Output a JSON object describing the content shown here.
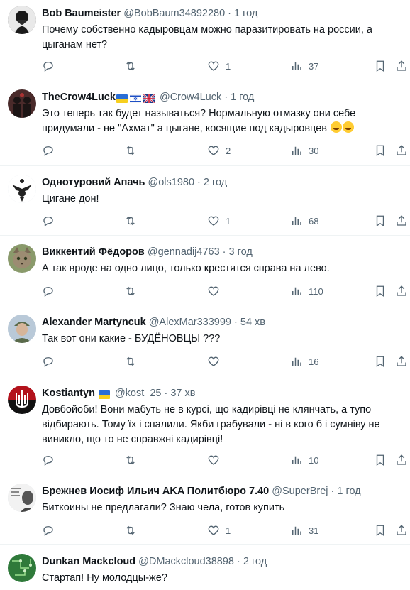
{
  "tweets": [
    {
      "name": "Bob Baumeister",
      "handle": "@BobBaum34892280",
      "time": "1 год",
      "text": "Почему собственно кадыровцам можно паразитировать на россии, а цыганам нет?",
      "replies": "",
      "reposts": "",
      "likes": "1",
      "views": "37",
      "avatar_icon": "bearded-man-avatar",
      "flags": []
    },
    {
      "name": "TheCrow4Luck",
      "handle": "@Crow4Luck",
      "time": "1 год",
      "text": "Это теперь так будет называться? Нормальную отмазку они себе придумали - не \"Ахмат\" а цыгане, косящие под кадыровцев",
      "emojis": [
        "rolling-laughing-emoji",
        "rolling-laughing-emoji"
      ],
      "replies": "",
      "reposts": "",
      "likes": "2",
      "views": "30",
      "avatar_icon": "dark-figures-avatar",
      "flags": [
        "ukraine-flag-icon",
        "israel-flag-icon",
        "uk-flag-icon"
      ]
    },
    {
      "name": "Однотуровий Апачь",
      "handle": "@ols1980",
      "time": "2 год",
      "text": "Цигане дон!",
      "replies": "",
      "reposts": "",
      "likes": "1",
      "views": "68",
      "avatar_icon": "eagle-emblem-avatar",
      "flags": []
    },
    {
      "name": "Виккентий Фёдоров",
      "handle": "@gennadij4763",
      "time": "3 год",
      "text": "А так вроде на одно лицо, только крестятся справа на лево.",
      "replies": "",
      "reposts": "",
      "likes": "",
      "views": "110",
      "avatar_icon": "cat-avatar",
      "flags": []
    },
    {
      "name": "Alexander Martyncuk",
      "handle": "@AlexMar333999",
      "time": "54 хв",
      "text": "Так вот они какие  - БУДЁНОВЦЫ ???",
      "replies": "",
      "reposts": "",
      "likes": "",
      "views": "16",
      "avatar_icon": "soldier-photo-avatar",
      "flags": []
    },
    {
      "name": "Kostiantyn",
      "handle": "@kost_25",
      "time": "37 хв",
      "text": "Довбойоби! Вони мабуть не в курсі, що кадирівці не клянчать, а тупо відбирають. Тому їх і спалили. Якби грабували - ні в кого б і сумніву не виникло, що то не справжні кадирівці!",
      "replies": "",
      "reposts": "",
      "likes": "",
      "views": "10",
      "avatar_icon": "trident-emblem-avatar",
      "flags": [
        "ukraine-flag-icon"
      ]
    },
    {
      "name": "Брежнев Иосиф Ильич AKA Политбюро 7.40",
      "handle": "@SuperBrej",
      "time": "1 год",
      "text": "Биткоины не предлагали? Знаю чела, готов купить",
      "replies": "",
      "reposts": "",
      "likes": "1",
      "views": "31",
      "avatar_icon": "portrait-sketch-avatar",
      "flags": []
    },
    {
      "name": "Dunkan Mackcloud",
      "handle": "@DMackcloud38898",
      "time": "2 год",
      "text": "Стартап! Ну молодцы-же?",
      "replies": "",
      "reposts": "",
      "likes": "",
      "views": "",
      "avatar_icon": "circuit-board-avatar",
      "flags": []
    }
  ],
  "colors": {
    "text": "#0f1419",
    "muted": "#536471",
    "divider": "#eff3f4",
    "background": "#ffffff"
  }
}
